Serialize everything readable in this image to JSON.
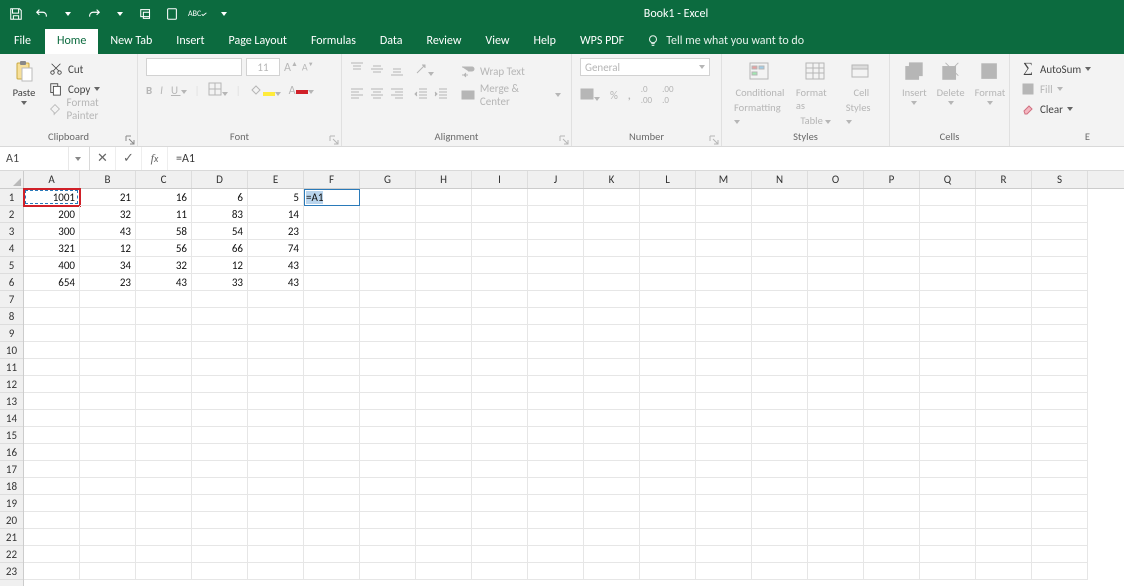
{
  "title": "Book1 - Excel",
  "tabs": {
    "file": "File",
    "home": "Home",
    "newtab": "New Tab",
    "insert": "Insert",
    "pagelayout": "Page Layout",
    "formulas": "Formulas",
    "data": "Data",
    "review": "Review",
    "view": "View",
    "help": "Help",
    "wpspdf": "WPS PDF",
    "tellme": "Tell me what you want to do"
  },
  "ribbon": {
    "clipboard": {
      "label": "Clipboard",
      "paste": "Paste",
      "cut": "Cut",
      "copy": "Copy",
      "format_painter": "Format Painter"
    },
    "font": {
      "label": "Font",
      "fontname": "",
      "fontsize": "11",
      "bold": "B",
      "italic": "I",
      "underline": "U"
    },
    "alignment": {
      "label": "Alignment",
      "wrap": "Wrap Text",
      "merge": "Merge & Center"
    },
    "number": {
      "label": "Number",
      "format": "General",
      "percent": "%",
      "comma": ","
    },
    "styles": {
      "label": "Styles",
      "cond": "Conditional Formatting",
      "cond1": "Conditional",
      "cond2": "Formatting",
      "table": "Format as Table",
      "table1": "Format as",
      "table2": "Table",
      "cell": "Cell Styles",
      "cell1": "Cell",
      "cell2": "Styles"
    },
    "cells": {
      "label": "Cells",
      "insert": "Insert",
      "delete": "Delete",
      "format": "Format"
    },
    "editing": {
      "label": "E",
      "autosum": "AutoSum",
      "fill": "Fill",
      "clear": "Clear"
    }
  },
  "namebox": "A1",
  "formula": "=A1",
  "columns": [
    "A",
    "B",
    "C",
    "D",
    "E",
    "F",
    "G",
    "H",
    "I",
    "J",
    "K",
    "L",
    "M",
    "N",
    "O",
    "P",
    "Q",
    "R",
    "S"
  ],
  "row_numbers": [
    1,
    2,
    3,
    4,
    5,
    6,
    7,
    8,
    9,
    10,
    11,
    12,
    13,
    14,
    15,
    16,
    17,
    18,
    19,
    20,
    21,
    22,
    23
  ],
  "cells": {
    "r1": {
      "A": "1001",
      "B": "21",
      "C": "16",
      "D": "6",
      "E": "5",
      "F": "=A1"
    },
    "r2": {
      "A": "200",
      "B": "32",
      "C": "11",
      "D": "83",
      "E": "14"
    },
    "r3": {
      "A": "300",
      "B": "43",
      "C": "58",
      "D": "54",
      "E": "23"
    },
    "r4": {
      "A": "321",
      "B": "12",
      "C": "56",
      "D": "66",
      "E": "74"
    },
    "r5": {
      "A": "400",
      "B": "34",
      "C": "32",
      "D": "12",
      "E": "43"
    },
    "r6": {
      "A": "654",
      "B": "23",
      "C": "43",
      "D": "33",
      "E": "43"
    }
  },
  "active_cell_display": "=A1",
  "source_cell": "A1"
}
